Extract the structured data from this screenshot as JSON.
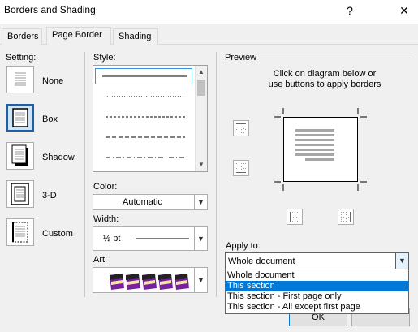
{
  "window": {
    "title": "Borders and Shading",
    "help_glyph": "?",
    "close_glyph": "✕"
  },
  "tabs": [
    {
      "label": "Borders",
      "selected": false
    },
    {
      "label": "Page Border",
      "selected": true
    },
    {
      "label": "Shading",
      "selected": false
    }
  ],
  "setting": {
    "label": "Setting:",
    "options": [
      {
        "label": "None",
        "selected": false
      },
      {
        "label": "Box",
        "selected": true
      },
      {
        "label": "Shadow",
        "selected": false
      },
      {
        "label": "3-D",
        "selected": false
      },
      {
        "label": "Custom",
        "selected": false
      }
    ]
  },
  "style": {
    "label": "Style:",
    "items": [
      "solid",
      "dotted",
      "dashed-small",
      "dashed",
      "dash-dot"
    ],
    "selected_index": 0
  },
  "color": {
    "label": "Color:",
    "value": "Automatic"
  },
  "width": {
    "label": "Width:",
    "value": "½ pt"
  },
  "art": {
    "label": "Art:",
    "icon": "cake-slice-icon"
  },
  "preview": {
    "label": "Preview",
    "instruction_line1": "Click on diagram below or",
    "instruction_line2": "use buttons to apply borders"
  },
  "apply_to": {
    "label": "Apply to:",
    "value": "Whole document",
    "options": [
      "Whole document",
      "This section",
      "This section - First page only",
      "This section - All except first page"
    ],
    "highlighted_index": 1
  },
  "buttons": {
    "ok": "OK"
  },
  "colors": {
    "accent": "#0078d7",
    "selection_bg": "#cde4f7",
    "dialog_bg": "#f0f0f0"
  }
}
